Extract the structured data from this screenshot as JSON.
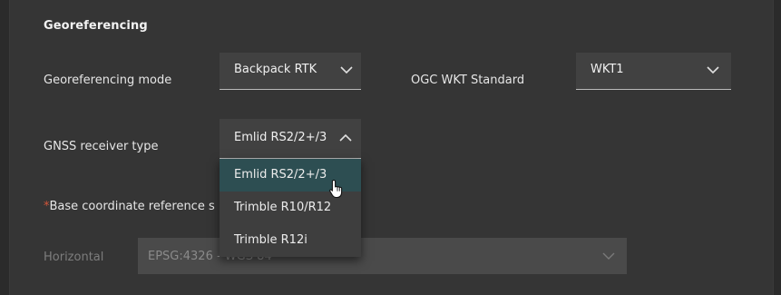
{
  "section": {
    "title": "Georeferencing"
  },
  "georef_mode": {
    "label": "Georeferencing mode",
    "value": "Backpack RTK"
  },
  "wkt": {
    "label": "OGC WKT Standard",
    "value": "WKT1"
  },
  "gnss": {
    "label": "GNSS receiver type",
    "value": "Emlid RS2/2+/3",
    "options": [
      {
        "label": "Emlid RS2/2+/3",
        "selected": true
      },
      {
        "label": "Trimble R10/R12",
        "selected": false
      },
      {
        "label": "Trimble R12i",
        "selected": false
      }
    ]
  },
  "base_crs": {
    "required_mark": "*",
    "label": "Base coordinate reference s"
  },
  "horizontal": {
    "label": "Horizontal",
    "value": "EPSG:4326 - WGS 84"
  },
  "colors": {
    "background": "#353535",
    "field": "#414141",
    "selected_option": "#2d4e52",
    "required": "#d2553a"
  },
  "icons": [
    "chevron-down-icon",
    "chevron-up-icon",
    "hand-pointer-cursor-icon"
  ]
}
